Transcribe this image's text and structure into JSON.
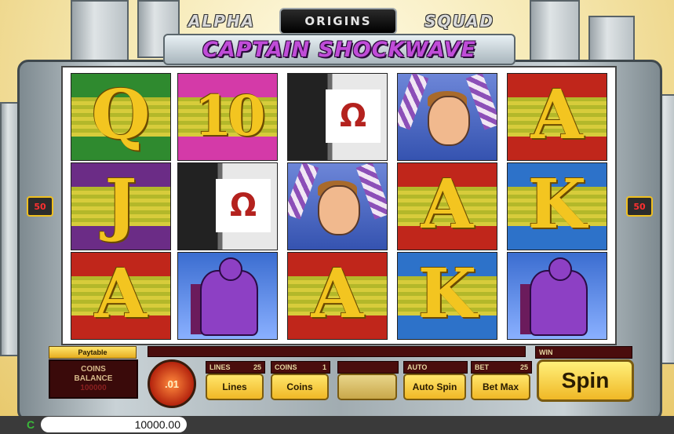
{
  "title": {
    "top_left": "ALPHA",
    "badge": "ORIGINS",
    "top_right": "SQUAD",
    "main": "CAPTAIN SHOCKWAVE"
  },
  "side_badges": {
    "left": "50",
    "right": "50"
  },
  "reels": [
    [
      {
        "symbol": "Q",
        "bg": "#2f8a2f",
        "kind": "letter"
      },
      {
        "symbol": "J",
        "bg": "#6b2c86",
        "kind": "letter"
      },
      {
        "symbol": "A",
        "bg": "#c0261b",
        "kind": "letter"
      }
    ],
    [
      {
        "symbol": "10",
        "bg": "#d43aa8",
        "kind": "letter"
      },
      {
        "symbol": "Ω",
        "bg": "#444",
        "kind": "cliff"
      },
      {
        "symbol": "",
        "bg": "#3b6dd0",
        "kind": "hero"
      }
    ],
    [
      {
        "symbol": "Ω",
        "bg": "#444",
        "kind": "cliff"
      },
      {
        "symbol": "",
        "bg": "#6d86d8",
        "kind": "man"
      },
      {
        "symbol": "A",
        "bg": "#c0261b",
        "kind": "letter"
      }
    ],
    [
      {
        "symbol": "",
        "bg": "#6d86d8",
        "kind": "man"
      },
      {
        "symbol": "A",
        "bg": "#c0261b",
        "kind": "letter"
      },
      {
        "symbol": "K",
        "bg": "#2d72c9",
        "kind": "letter"
      }
    ],
    [
      {
        "symbol": "A",
        "bg": "#c0261b",
        "kind": "letter"
      },
      {
        "symbol": "K",
        "bg": "#2d72c9",
        "kind": "letter"
      },
      {
        "symbol": "",
        "bg": "#3b6dd0",
        "kind": "hero"
      }
    ]
  ],
  "controls": {
    "paytable": "Paytable",
    "coins_balance_label_1": "COINS",
    "coins_balance_label_2": "BALANCE",
    "coins_balance_value": "100000",
    "coin_value": ".01",
    "lines_label": "LINES",
    "lines_value": "25",
    "lines_button": "Lines",
    "coins_label": "COINS",
    "coins_value": "1",
    "coins_button": "Coins",
    "auto_label": "AUTO",
    "auto_button": "Auto Spin",
    "bet_label": "BET",
    "bet_value": "25",
    "bet_button": "Bet Max",
    "win_label": "WIN",
    "spin_button": "Spin"
  },
  "bottom": {
    "currency_icon": "C",
    "balance": "10000.00"
  }
}
